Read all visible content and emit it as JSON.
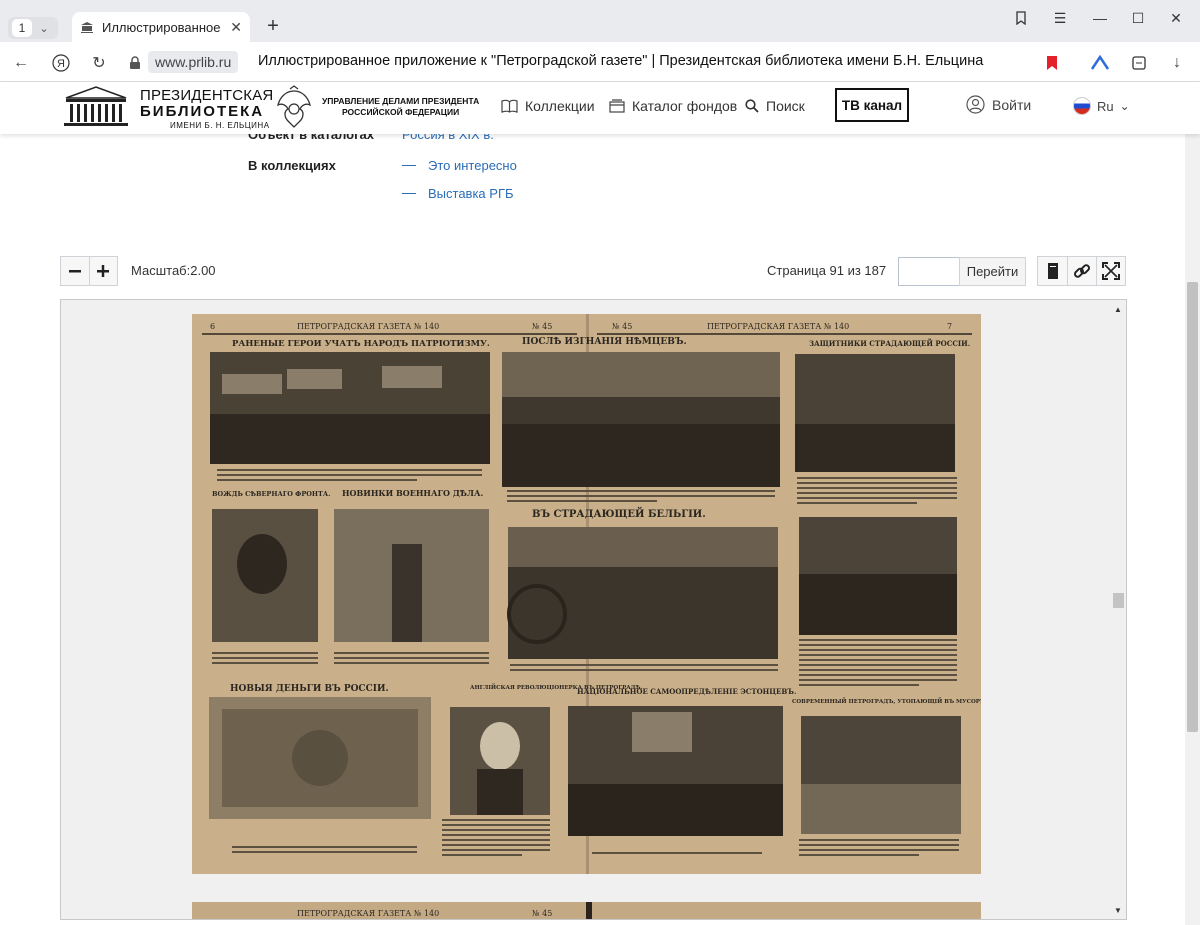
{
  "browser": {
    "tab_count": "1",
    "tab_title": "Иллюстрированное пр",
    "url": "www.prlib.ru",
    "page_title": "Иллюстрированное приложение к \"Петроградской газете\" | Президентская библиотека имени Б.Н. Ельцина"
  },
  "site": {
    "logo": {
      "line1": "ПРЕЗИДЕНТСКАЯ",
      "line2": "БИБЛИОТЕКА",
      "line3": "ИМЕНИ Б. Н. ЕЛЬЦИНА"
    },
    "admin": {
      "line1": "УПРАВЛЕНИЕ ДЕЛАМИ ПРЕЗИДЕНТА",
      "line2": "РОССИЙСКОЙ ФЕДЕРАЦИИ"
    },
    "nav": {
      "collections": "Коллекции",
      "catalog": "Каталог фондов",
      "search": "Поиск",
      "tv": "ТВ канал",
      "login": "Войти",
      "lang": "Ru"
    }
  },
  "meta": {
    "catalog_label": "Объект в каталогах",
    "catalog_value": "Россия в XIX в.",
    "collections_label": "В коллекциях",
    "collections": [
      "Это интересно",
      "Выставка РГБ"
    ]
  },
  "viewer": {
    "scale_label": "Масштаб:2.00",
    "page_counter": "Страница 91 из 187",
    "page_input": "",
    "goto_label": "Перейти"
  },
  "scan": {
    "header_left": "ПЕТРОГРАДСКАЯ ГАЗЕТА № 140",
    "header_right": "ПЕТРОГРАДСКАЯ ГАЗЕТА № 140",
    "issue_left": "№ 45",
    "issue_right": "№ 45",
    "page_left": "6",
    "page_right": "7",
    "headlines": [
      "РАНЕНЫЕ ГЕРОИ УЧАТЪ НАРОДЪ ПАТРІОТИЗМУ.",
      "ПОСЛѢ ИЗГНАНІЯ НѢМЦЕВЪ.",
      "ЗАЩИТНИКИ СТРАДАЮЩЕЙ РОССІИ.",
      "ВОЖДЬ СѢВЕРНАГО ФРОНТА.",
      "НОВИНКИ ВОЕННАГО ДѢЛА.",
      "ВЪ СТРАДАЮЩЕЙ БЕЛЬГІИ.",
      "НОВЫЯ ДЕНЬГИ ВЪ РОССІИ.",
      "АНГЛІЙСКАЯ РЕВОЛЮЦІОНЕРКА ВЪ ПЕТРОГРАДѢ.",
      "НАЦІОНАЛЬНОЕ САМООПРЕДѢЛЕНІЕ ЭСТОНЦЕВЪ.",
      "СОВРЕМЕННЫЙ ПЕТРОГРАДЪ, УТОПАЮЩІЙ ВЪ МУСОРѢ."
    ]
  }
}
